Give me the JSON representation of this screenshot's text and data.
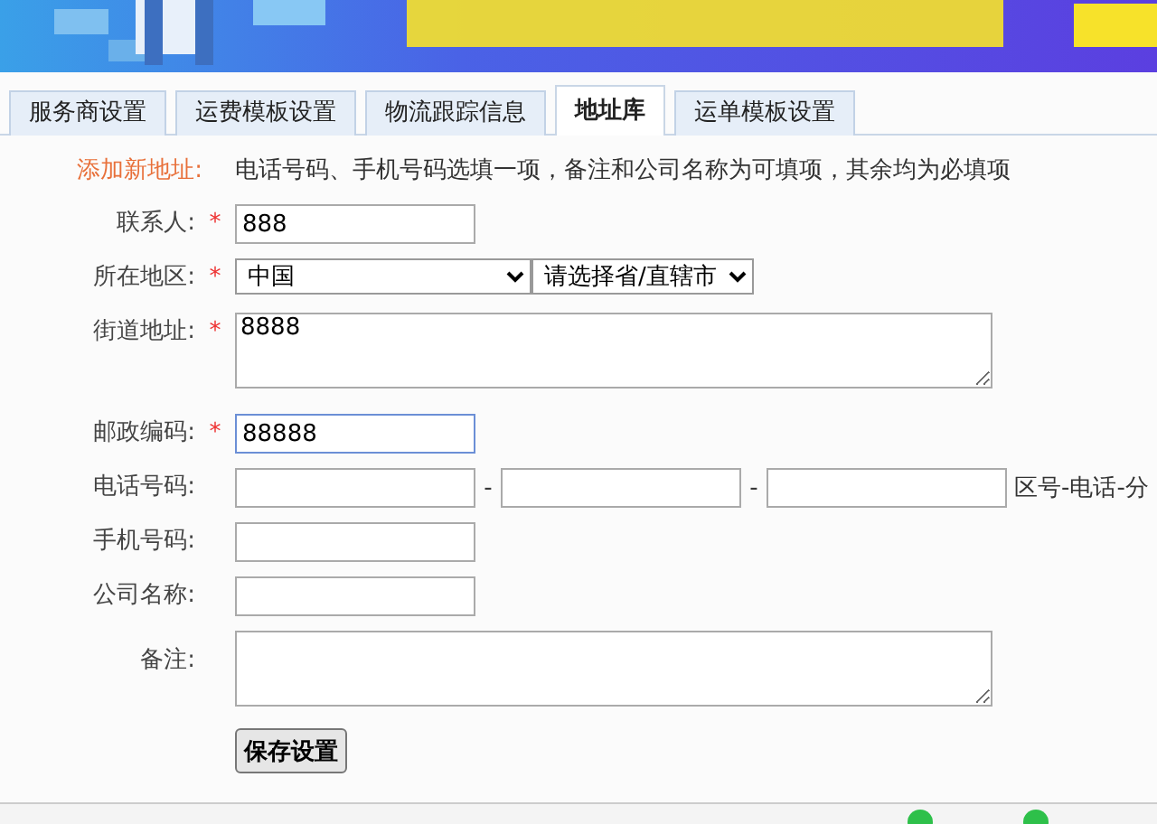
{
  "tabs": [
    {
      "label": "服务商设置",
      "selected": false
    },
    {
      "label": "运费模板设置",
      "selected": false
    },
    {
      "label": "物流跟踪信息",
      "selected": false
    },
    {
      "label": "地址库",
      "selected": true
    },
    {
      "label": "运单模板设置",
      "selected": false
    }
  ],
  "form": {
    "heading": "添加新地址:",
    "notice": "电话号码、手机号码选填一项，备注和公司名称为可填项，其余均为必填项",
    "fields": [
      {
        "kind": "text",
        "label": "联系人:",
        "required_mark": "*",
        "value": "888",
        "focused": false
      },
      {
        "kind": "select",
        "label": "所在地区:",
        "required_mark": "*",
        "options": [
          "中国",
          "请选择省/直辖市"
        ]
      },
      {
        "kind": "textarea",
        "label": "街道地址:",
        "required_mark": "*",
        "value": "8888"
      },
      {
        "kind": "text",
        "label": "邮政编码:",
        "required_mark": "*",
        "value": "88888",
        "focused": true
      },
      {
        "kind": "phone",
        "label": "电话号码:",
        "separators": [
          "-",
          "-"
        ],
        "hint": "区号-电话-分"
      },
      {
        "kind": "text",
        "label": "手机号码:",
        "focused": false
      },
      {
        "kind": "text",
        "label": "公司名称:",
        "focused": false
      },
      {
        "kind": "textarea",
        "label": "备注:"
      }
    ],
    "submit": "保存设置"
  }
}
